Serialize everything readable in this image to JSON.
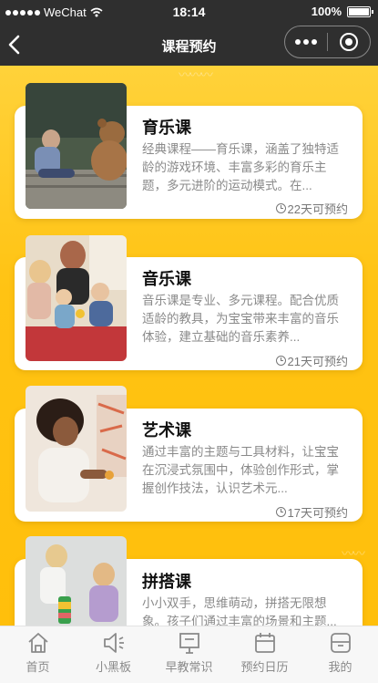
{
  "status": {
    "carrier": "WeChat",
    "time": "18:14",
    "battery": "100%",
    "battery_level": 1.0
  },
  "nav": {
    "title": "课程预约"
  },
  "courses": [
    {
      "title": "育乐课",
      "desc": "经典课程——育乐课，涵盖了独特适龄的游戏环境、丰富多彩的育乐主题，多元进阶的运动模式。在...",
      "days": "22天可预约"
    },
    {
      "title": "音乐课",
      "desc": "音乐课是专业、多元课程。配合优质适龄的教具，为宝宝带来丰富的音乐体验，建立基础的音乐素养...",
      "days": "21天可预约"
    },
    {
      "title": "艺术课",
      "desc": "通过丰富的主题与工具材料，让宝宝在沉浸式氛围中，体验创作形式，掌握创作技法，认识艺术元...",
      "days": "17天可预约"
    },
    {
      "title": "拼搭课",
      "desc": "小小双手，思维萌动，拼搭无限想象。孩子们通过丰富的场景和主题...",
      "days": ""
    }
  ],
  "tabs": [
    {
      "label": "首页",
      "icon": "home-icon"
    },
    {
      "label": "小黑板",
      "icon": "speaker-icon"
    },
    {
      "label": "早教常识",
      "icon": "signboard-icon"
    },
    {
      "label": "预约日历",
      "icon": "calendar-icon"
    },
    {
      "label": "我的",
      "icon": "profile-box-icon"
    }
  ]
}
